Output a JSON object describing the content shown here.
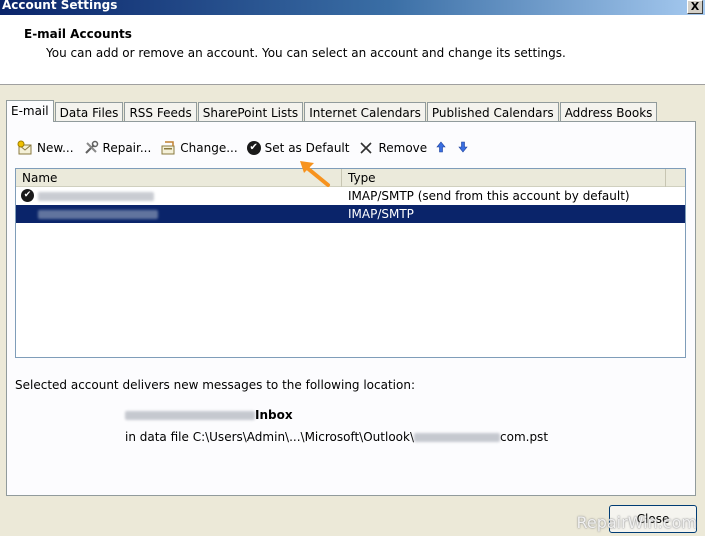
{
  "window": {
    "title": "Account Settings",
    "close_glyph": "X"
  },
  "header": {
    "title": "E-mail Accounts",
    "subtitle": "You can add or remove an account. You can select an account and change its settings."
  },
  "tabs": [
    {
      "label": "E-mail",
      "active": true
    },
    {
      "label": "Data Files"
    },
    {
      "label": "RSS Feeds"
    },
    {
      "label": "SharePoint Lists"
    },
    {
      "label": "Internet Calendars"
    },
    {
      "label": "Published Calendars"
    },
    {
      "label": "Address Books"
    }
  ],
  "toolbar": {
    "new_label": "New...",
    "repair_label": "Repair...",
    "change_label": "Change...",
    "set_default_label": "Set as Default",
    "remove_label": "Remove",
    "move_up_icon": "arrow-up-icon",
    "move_down_icon": "arrow-down-icon"
  },
  "accounts_list": {
    "columns": [
      "Name",
      "Type"
    ],
    "rows": [
      {
        "type": "IMAP/SMTP (send from this account by default)",
        "is_default": true,
        "selected": false
      },
      {
        "type": "IMAP/SMTP",
        "is_default": false,
        "selected": true
      }
    ]
  },
  "delivery": {
    "text": "Selected account delivers new messages to the following location:",
    "folder": "Inbox",
    "file_prefix": "in data file C:\\Users\\Admin\\...\\Microsoft\\Outlook\\",
    "file_suffix": "com.pst"
  },
  "footer": {
    "close_label": "Close"
  },
  "watermark": "RepairWin.com",
  "colors": {
    "selection": "#0a246a",
    "annotation_arrow": "#f7931e",
    "titlebar": "#0a246a"
  }
}
